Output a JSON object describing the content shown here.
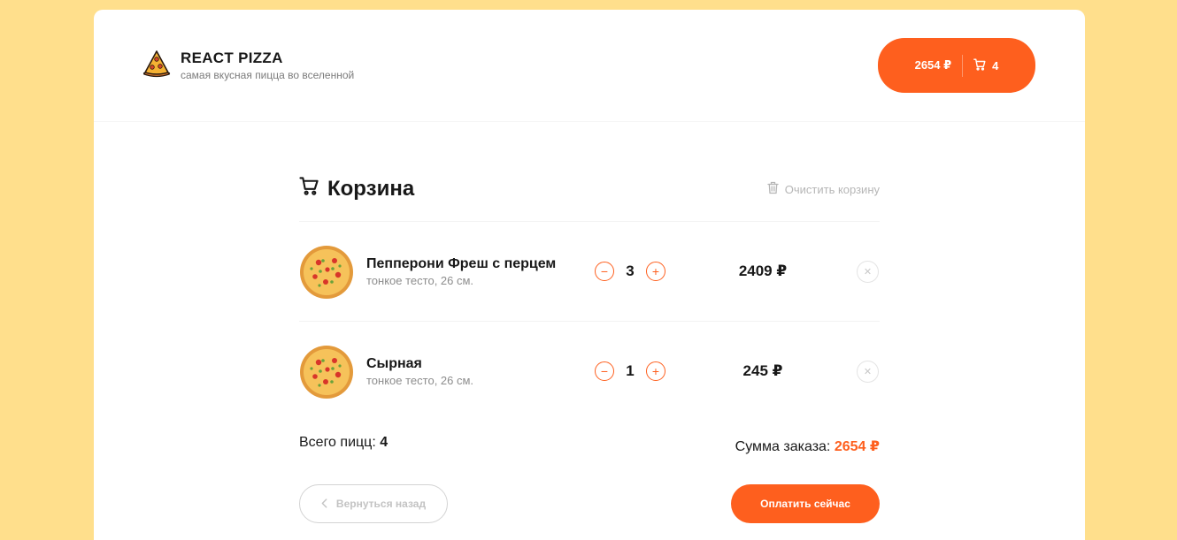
{
  "header": {
    "title": "REACT PIZZA",
    "subtitle": "самая вкусная пицца во вселенной",
    "cart_price": "2654 ₽",
    "cart_count": "4",
    "logo_icon": "pizza-slice-icon",
    "cart_icon": "cart-icon"
  },
  "cart": {
    "title": "Корзина",
    "clear_label": "Очистить корзину",
    "items": [
      {
        "name": "Пепперони Фреш с перцем",
        "desc": "тонкое тесто, 26 см.",
        "qty": "3",
        "price": "2409 ₽"
      },
      {
        "name": "Сырная",
        "desc": "тонкое тесто, 26 см.",
        "qty": "1",
        "price": "245 ₽"
      }
    ],
    "minus": "−",
    "plus": "+",
    "remove": "✕",
    "total_count_label": "Всего пицц:",
    "total_count": "4",
    "total_sum_label": "Сумма заказа:",
    "total_sum": "2654 ₽",
    "back_label": "Вернуться назад",
    "pay_label": "Оплатить сейчас"
  },
  "colors": {
    "background": "#ffdf8c",
    "accent": "#fe5f1e"
  }
}
